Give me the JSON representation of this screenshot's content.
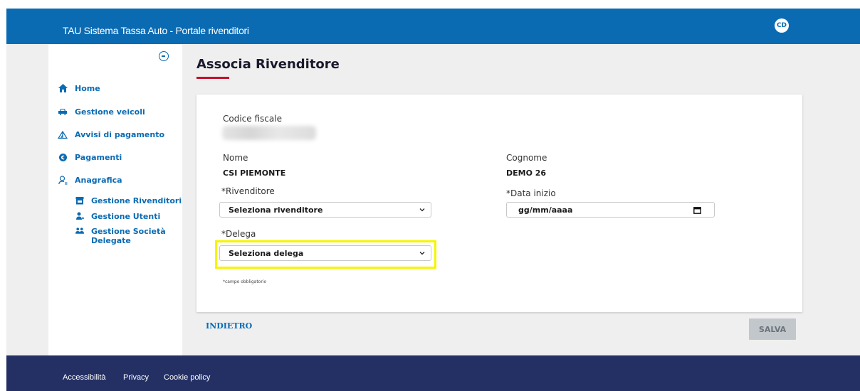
{
  "header": {
    "title": "TAU Sistema Tassa Auto - Portale rivenditori",
    "avatar_initials": "CD",
    "accent_color": "#0a6bb3"
  },
  "sidebar": {
    "collapse_icon": "minus-circle-icon",
    "items": [
      {
        "label": "Home",
        "icon": "home-icon"
      },
      {
        "label": "Gestione veicoli",
        "icon": "car-icon"
      },
      {
        "label": "Avvisi di pagamento",
        "icon": "tent-icon"
      },
      {
        "label": "Pagamenti",
        "icon": "euro-coin-icon"
      },
      {
        "label": "Anagrafica",
        "icon": "user-icon"
      }
    ],
    "sub_items": [
      {
        "label": "Gestione Rivenditori",
        "icon": "store-icon"
      },
      {
        "label": "Gestione Utenti",
        "icon": "user-add-icon"
      },
      {
        "label": "Gestione Società Delegate",
        "icon": "people-icon"
      }
    ]
  },
  "page": {
    "title": "Associa Rivenditore"
  },
  "form": {
    "codice_fiscale_label": "Codice fiscale",
    "nome_label": "Nome",
    "nome_value": "CSI PIEMONTE",
    "cognome_label": "Cognome",
    "cognome_value": "DEMO 26",
    "rivenditore_label": "*Rivenditore",
    "rivenditore_value": "Seleziona rivenditore",
    "data_inizio_label": "*Data inizio",
    "data_inizio_placeholder": "gg/mm/aaaa",
    "delega_label": "*Delega",
    "delega_value": "Seleziona delega",
    "required_note": "*campo obbligatorio"
  },
  "actions": {
    "back_label": "INDIETRO",
    "save_label": "SALVA"
  },
  "footer": {
    "links": [
      "Accessibilità",
      "Privacy",
      "Cookie policy"
    ]
  },
  "colors": {
    "header_bg": "#0a6bb3",
    "footer_bg": "#243064",
    "title_underline": "#c8102e",
    "highlight_border": "#f5f500",
    "save_disabled_bg": "#c2c7cc"
  }
}
